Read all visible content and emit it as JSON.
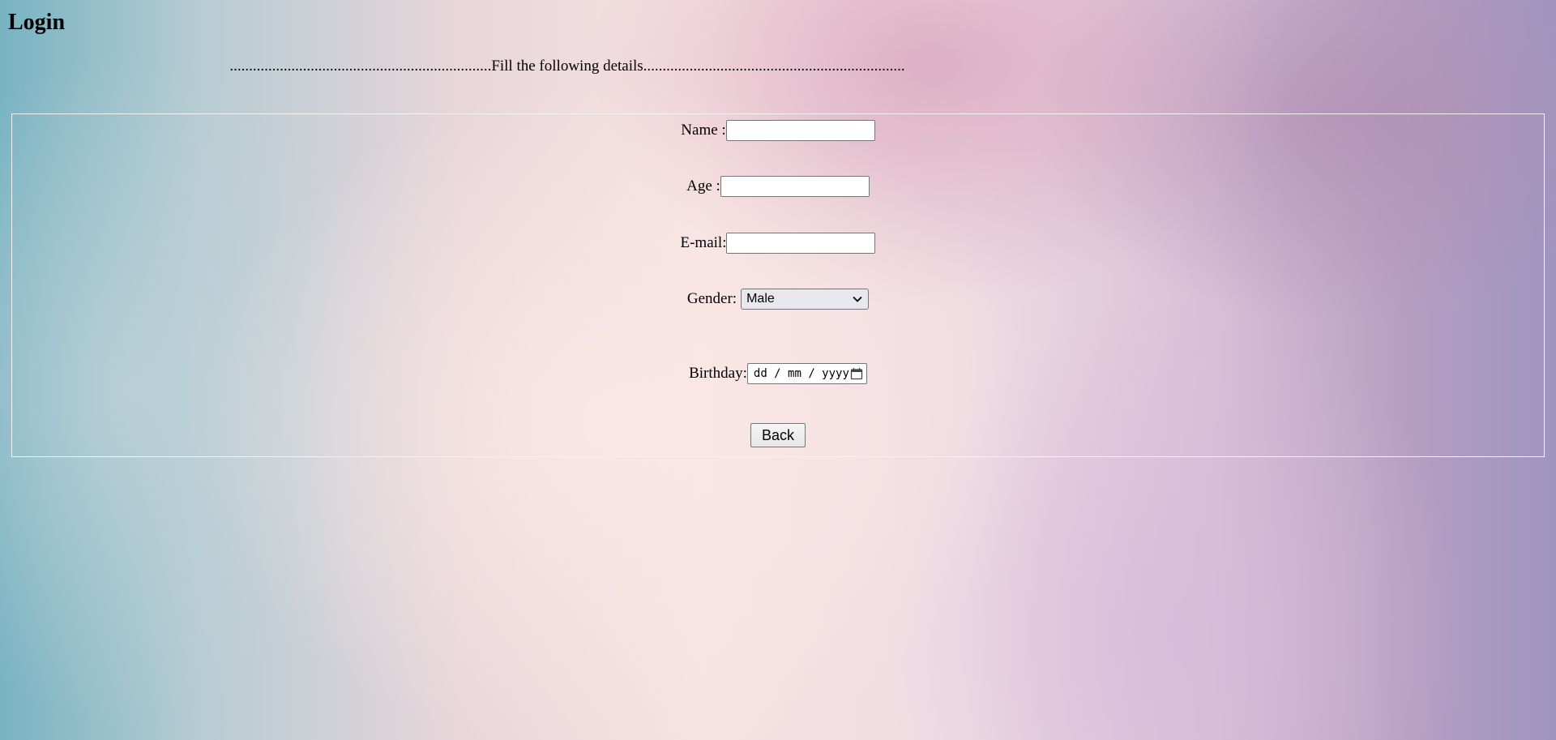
{
  "page": {
    "title": "Login",
    "subtitle": "....................................................................Fill the following details...................................................................."
  },
  "form": {
    "name_label": "Name :",
    "name_value": "",
    "age_label": "Age :",
    "age_value": "",
    "email_label": "E-mail:",
    "email_value": "",
    "gender_label": "Gender:",
    "gender_selected": "Male",
    "birthday_label": "Birthday:",
    "birthday_placeholder": "dd / mm / yyyy",
    "back_label": "Back"
  },
  "icons": {
    "gender_dropdown": "chevron-down-icon",
    "birthday_picker": "calendar-icon"
  },
  "colors": {
    "border": "#f2f2f2",
    "input_border": "#767676",
    "select_bg": "#e9e7ee"
  }
}
